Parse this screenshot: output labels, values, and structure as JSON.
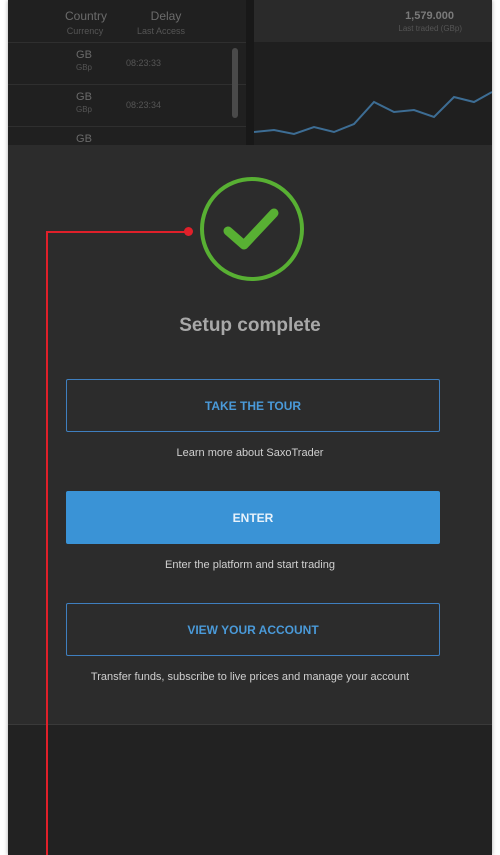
{
  "background": {
    "header": {
      "country_label": "Country",
      "country_sub": "Currency",
      "delay_label": "Delay",
      "delay_sub": "Last Access",
      "price": "1,579.000",
      "price_sub": "Last traded (GBp)"
    },
    "rows": [
      {
        "country": "GB",
        "currency": "GBp",
        "time": "08:23:33"
      },
      {
        "country": "GB",
        "currency": "GBp",
        "time": "08:23:34"
      },
      {
        "country": "GB",
        "currency": "",
        "time": ""
      }
    ]
  },
  "modal": {
    "title": "Setup complete",
    "tour_button": "TAKE THE TOUR",
    "tour_desc": "Learn more about SaxoTrader",
    "enter_button": "ENTER",
    "enter_desc": "Enter the platform and start trading",
    "account_button": "VIEW YOUR ACCOUNT",
    "account_desc": "Transfer funds, subscribe to live prices and manage your account"
  },
  "colors": {
    "accent_blue": "#3a93d6",
    "success_green": "#58b033",
    "annotation_red": "#e0202a"
  }
}
